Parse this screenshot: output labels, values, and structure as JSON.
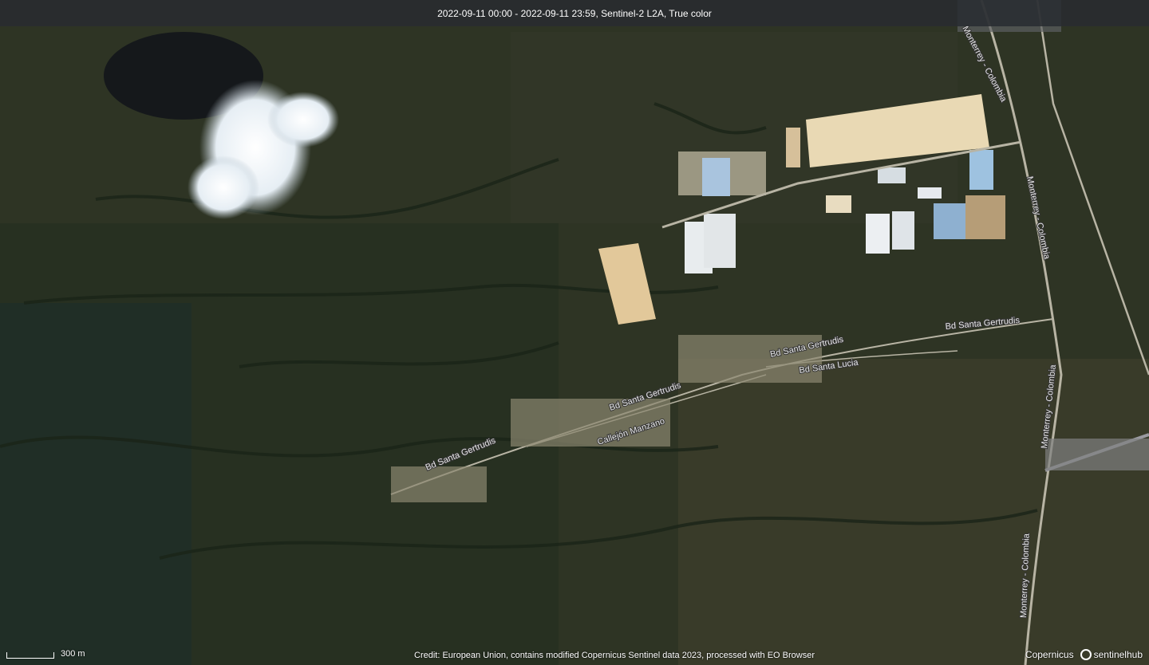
{
  "header": {
    "text": "2022-09-11 00:00 - 2022-09-11 23:59, Sentinel-2 L2A, True color"
  },
  "map": {
    "road_labels": {
      "road1": "Monterrey - Colombia",
      "road2": "Monterrey - Colombia",
      "road3": "Monterrey - Colombia",
      "road4": "Monterrey - Colombia",
      "sg1": "Bd Santa Gertrudis",
      "sg2": "Bd Santa Gertrudis",
      "sg3": "Bd Santa Gertrudis",
      "sg4": "Bd Santa Gertrudis",
      "lucia": "Bd Santa Lucia",
      "manzano": "Callejón Manzano"
    }
  },
  "footer": {
    "scale_label": "300 m",
    "credit": "Credit: European Union, contains modified Copernicus Sentinel data 2023, processed with EO Browser",
    "logo_copernicus": "Copernicus",
    "logo_sentinelhub": "sentinelhub"
  }
}
